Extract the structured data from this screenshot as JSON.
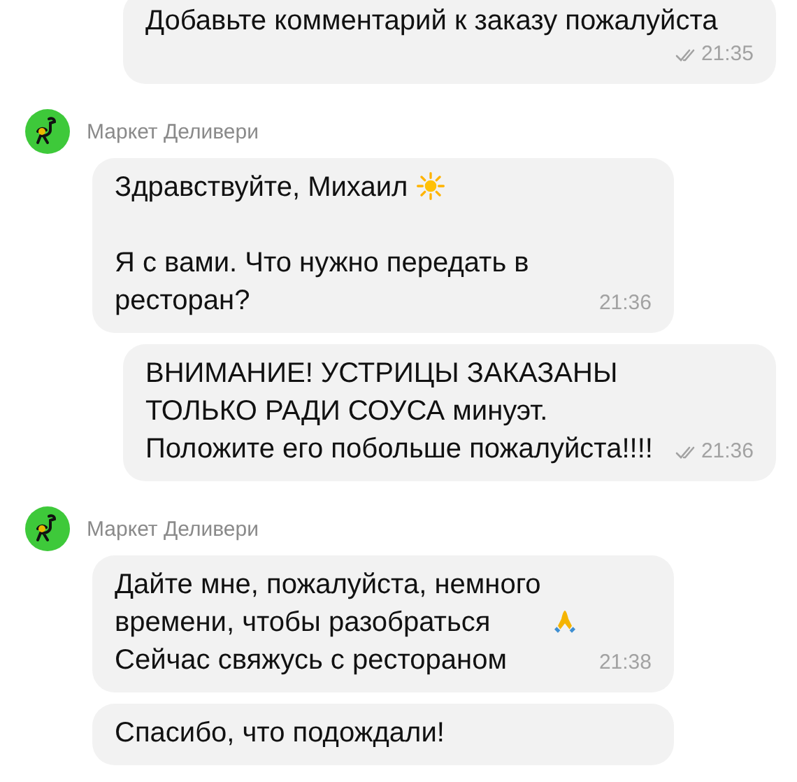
{
  "messages": [
    {
      "kind": "outgoing",
      "blocks": [
        [
          {
            "text": "Добавьте комментарий к заказу пожалуйста"
          }
        ]
      ],
      "time": "21:35"
    },
    {
      "kind": "sender",
      "name": "Маркет Деливери"
    },
    {
      "kind": "incoming",
      "blocks": [
        [
          {
            "text": "Здравствуйте, Михаил",
            "kind": "sun"
          }
        ],
        [
          {
            "text": "Я с вами. Что нужно передать в ресторан?"
          }
        ]
      ],
      "time": "21:36"
    },
    {
      "kind": "outgoing",
      "blocks": [
        [
          {
            "text": "ВНИМАНИЕ! УСТРИЦЫ ЗАКАЗАНЫ ТОЛЬКО РАДИ СОУСА минуэт. Положите его побольше пожалуйста!!!!"
          }
        ]
      ],
      "time": "21:36"
    },
    {
      "kind": "sender",
      "name": "Маркет Деливери"
    },
    {
      "kind": "incoming",
      "blocks": [
        [
          {
            "text": "Дайте мне, пожалуйста, немного времени, чтобы разобраться",
            "kind": "prayer"
          },
          {
            "text": "Сейчас свяжусь с рестораном"
          }
        ]
      ],
      "time": "21:38"
    },
    {
      "kind": "incoming",
      "blocks": [
        [
          {
            "text": "Спасибо, что подождали!"
          }
        ]
      ]
    }
  ]
}
